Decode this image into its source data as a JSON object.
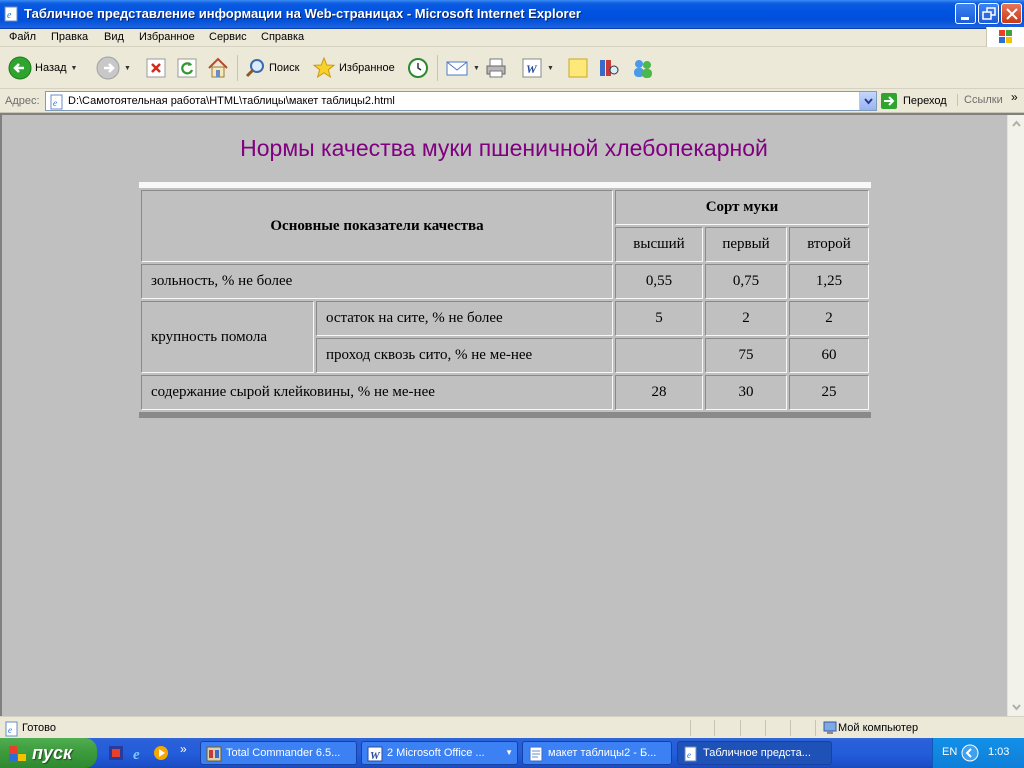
{
  "window": {
    "title": "Табличное представление информации на Web-страницах - Microsoft Internet Explorer"
  },
  "menu": [
    "Файл",
    "Правка",
    "Вид",
    "Избранное",
    "Сервис",
    "Справка"
  ],
  "toolbar": {
    "back": "Назад",
    "search": "Поиск",
    "favorites": "Избранное"
  },
  "address": {
    "label": "Адрес:",
    "url": "D:\\Самотоятельная работа\\HTML\\таблицы\\макет таблицы2.html",
    "go": "Переход",
    "links": "Ссылки"
  },
  "page": {
    "title": "Нормы качества муки пшеничной хлебопекарной",
    "table": {
      "header_main": "Основные показатели качества",
      "header_group": "Сорт муки",
      "grades": [
        "высший",
        "первый",
        "второй"
      ],
      "rows": [
        {
          "label": "зольность, % не более",
          "values": [
            "0,55",
            "0,75",
            "1,25"
          ]
        },
        {
          "group": "крупность помола",
          "label": "остаток на сите, % не более",
          "values": [
            "5",
            "2",
            "2"
          ]
        },
        {
          "label": "проход сквозь сито, % не ме-нее",
          "values": [
            "",
            "75",
            "60"
          ]
        },
        {
          "label": "содержание сырой клейковины, % не ме-нее",
          "values": [
            "28",
            "30",
            "25"
          ]
        }
      ]
    }
  },
  "status": {
    "text": "Готово",
    "zone": "Мой компьютер"
  },
  "taskbar": {
    "start": "пуск",
    "items": [
      "Total Commander 6.5...",
      "2 Microsoft Office ...",
      "макет таблицы2 - Б...",
      "Табличное предста..."
    ],
    "lang": "EN",
    "clock": "1:03"
  },
  "colors": {
    "title_text": "#800080",
    "page_background": "#C0C0C0",
    "titlebar": "#0054E3",
    "taskbar": "#245EDB"
  }
}
